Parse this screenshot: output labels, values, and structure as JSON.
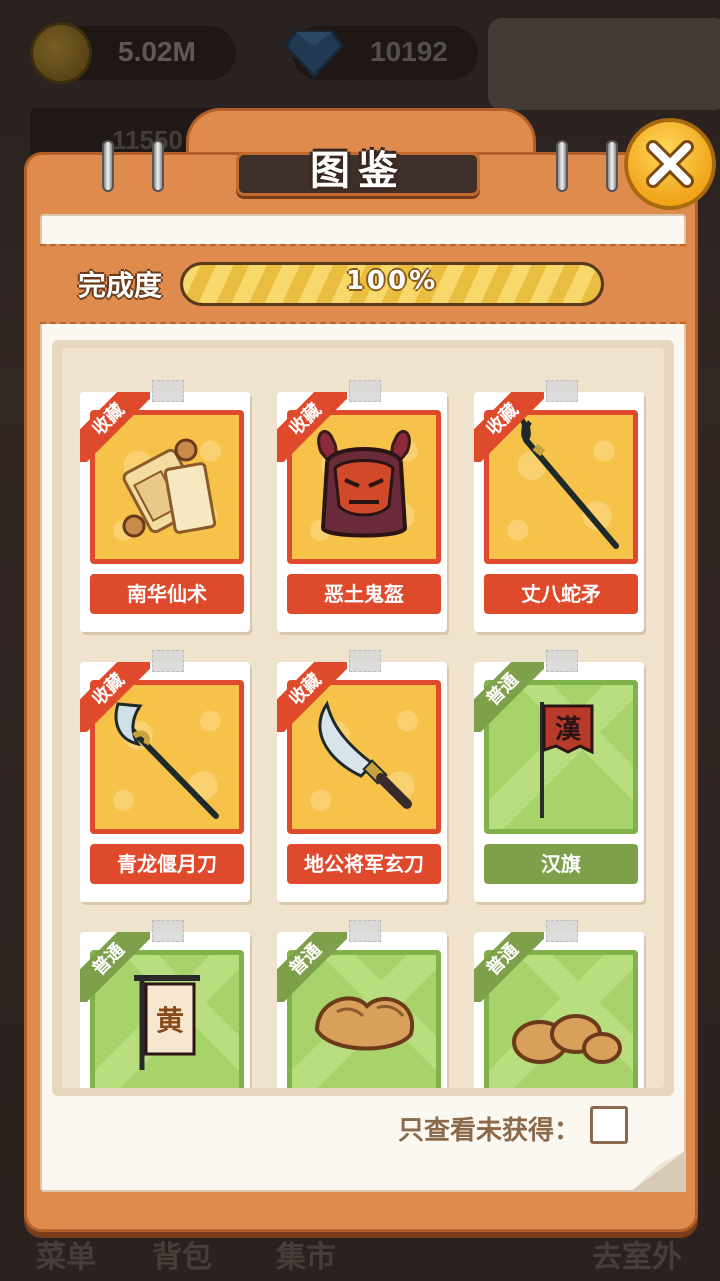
{
  "topbar": {
    "coins": "5.02M",
    "gems": "10192",
    "level_value": "11550"
  },
  "bottom_nav": [
    "菜单",
    "背包",
    "集市",
    "去室外"
  ],
  "modal": {
    "title": "图鉴",
    "progress_label": "完成度",
    "progress_text": "100%",
    "progress_value": 1.0,
    "filter_label": "只查看未获得：",
    "filter_checked": false
  },
  "items": [
    {
      "name": "南华仙术",
      "rarity": "收藏",
      "tier": "rare",
      "icon": "scroll-icon"
    },
    {
      "name": "恶土鬼盔",
      "rarity": "收藏",
      "tier": "rare",
      "icon": "demon-helmet-icon"
    },
    {
      "name": "丈八蛇矛",
      "rarity": "收藏",
      "tier": "rare",
      "icon": "serpent-spear-icon"
    },
    {
      "name": "青龙偃月刀",
      "rarity": "收藏",
      "tier": "rare",
      "icon": "crescent-blade-icon"
    },
    {
      "name": "地公将军玄刀",
      "rarity": "收藏",
      "tier": "rare",
      "icon": "broad-sword-icon"
    },
    {
      "name": "汉旗",
      "rarity": "普通",
      "tier": "common",
      "icon": "han-flag-icon",
      "flag_char": "漢"
    },
    {
      "name": "",
      "rarity": "普通",
      "tier": "common",
      "icon": "yellow-banner-icon",
      "flag_char": "黄"
    },
    {
      "name": "",
      "rarity": "普通",
      "tier": "common",
      "icon": "gold-ingot-icon"
    },
    {
      "name": "",
      "rarity": "普通",
      "tier": "common",
      "icon": "gold-nuggets-icon"
    }
  ]
}
